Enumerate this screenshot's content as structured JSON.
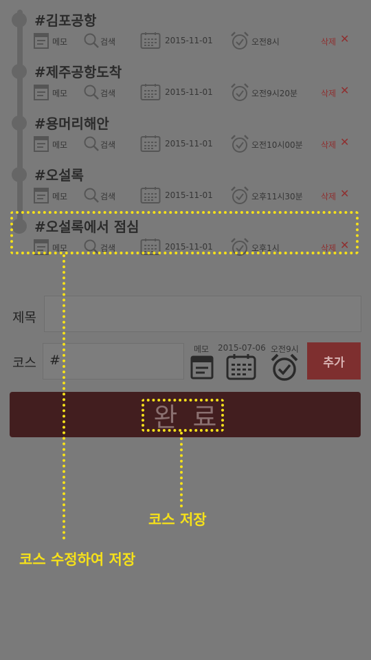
{
  "courses": [
    {
      "title": "#김포공항",
      "memo": "메모",
      "search": "검색",
      "date": "2015-11-01",
      "time": "오전8시",
      "delete": "삭제",
      "delete_x": "✕"
    },
    {
      "title": "#제주공항도착",
      "memo": "메모",
      "search": "검색",
      "date": "2015-11-01",
      "time": "오전9시20분",
      "delete": "삭제",
      "delete_x": "✕"
    },
    {
      "title": "#용머리해안",
      "memo": "메모",
      "search": "검색",
      "date": "2015-11-01",
      "time": "오전10시00분",
      "delete": "삭제",
      "delete_x": "✕"
    },
    {
      "title": "#오설록",
      "memo": "메모",
      "search": "검색",
      "date": "2015-11-01",
      "time": "오후11시30분",
      "delete": "삭제",
      "delete_x": "✕"
    },
    {
      "title": "#오설록에서 점심",
      "memo": "메모",
      "search": "검색",
      "date": "2015-11-01",
      "time": "오후1시",
      "delete": "삭제",
      "delete_x": "✕"
    }
  ],
  "form": {
    "title_label": "제목",
    "title_value": "",
    "course_label": "코스",
    "course_value": "#",
    "memo_label": "메모",
    "date_label": "2015-07-06",
    "time_label": "오전9시",
    "add_button": "추가",
    "done_button": "완료"
  },
  "annotations": {
    "edit_save": "코스 수정하여 저장",
    "course_save": "코스 저장"
  },
  "colors": {
    "highlight": "#f6e11a",
    "delete": "#8f2f2f",
    "add_button": "#7e2f2f",
    "done_button": "#421e1f"
  }
}
